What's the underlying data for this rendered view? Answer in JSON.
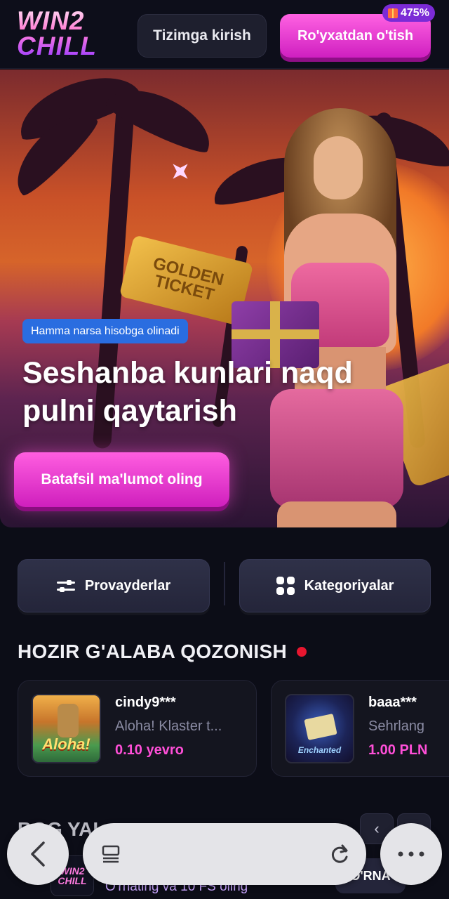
{
  "header": {
    "logo_line1": "WIN2",
    "logo_line2": "CHILL",
    "login_label": "Tizimga kirish",
    "register_label": "Ro'yxatdan o'tish",
    "bonus_badge": "475%"
  },
  "hero": {
    "ticket_text": "GOLDEN TICKET",
    "tag": "Hamma narsa hisobga olinadi",
    "title": "Seshanba kunlari naqd pulni qaytarish",
    "cta_label": "Batafsil ma'lumot oling"
  },
  "filters": {
    "providers_label": "Provayderlar",
    "categories_label": "Kategoriyalar"
  },
  "live_wins": {
    "title": "HOZIR G'ALABA QOZONISH",
    "items": [
      {
        "user": "cindy9***",
        "game": "Aloha! Klaster t...",
        "amount": "0.10 yevro",
        "thumb_text": "Aloha!"
      },
      {
        "user": "baaa***",
        "game": "Sehrlang",
        "amount": "1.00 PLN",
        "thumb_text": "Enchanted"
      }
    ]
  },
  "next_section": {
    "title": "BOG YAL...",
    "peek_logo": "WIN2 CHILL",
    "peek_text": "O'rnating va 10 FS oling",
    "peek_button": "O'RNA"
  },
  "colors": {
    "accent": "#e23ad0",
    "win_amount": "#ff4fd8",
    "live_dot": "#e8162f",
    "tag_blue": "#2a6de0"
  }
}
